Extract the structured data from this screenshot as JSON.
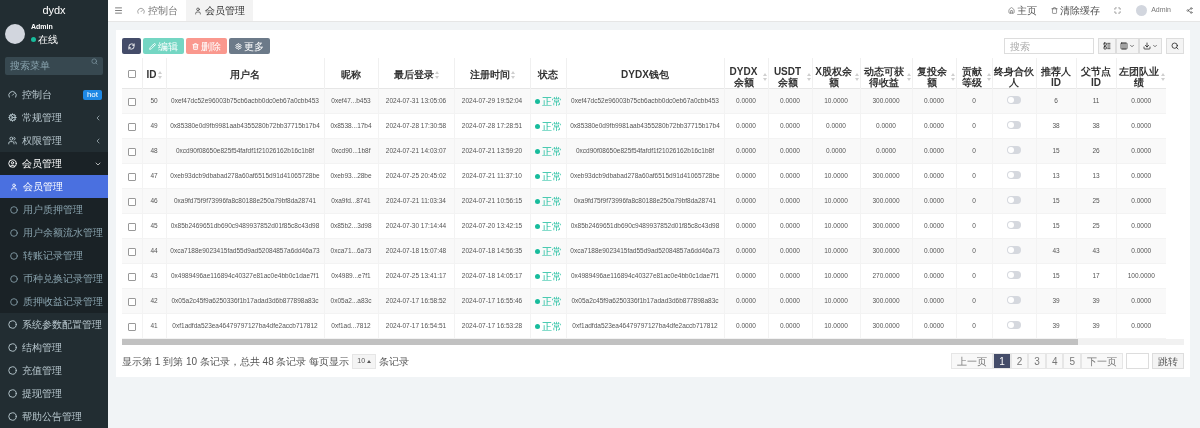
{
  "sidebar": {
    "brand": "dydx",
    "user": {
      "name": "Admin",
      "status": "在线",
      "online": true
    },
    "search": {
      "placeholder": "搜索菜单"
    },
    "items": [
      {
        "label": "控制台",
        "badge": "hot",
        "selected": false
      },
      {
        "label": "常规管理",
        "expanded": false,
        "selected": false
      },
      {
        "label": "权限管理",
        "expanded": false,
        "selected": false
      },
      {
        "label": "会员管理",
        "expanded": true,
        "selected": false,
        "children": [
          {
            "label": "会员管理",
            "selected": true
          },
          {
            "label": "用户质押管理",
            "selected": false
          },
          {
            "label": "用户余额流水管理",
            "selected": false
          },
          {
            "label": "转账记录管理",
            "selected": false
          },
          {
            "label": "币种兑换记录管理",
            "selected": false
          },
          {
            "label": "质押收益记录管理",
            "selected": false
          }
        ]
      },
      {
        "label": "系统参数配置管理",
        "selected": false
      },
      {
        "label": "结构管理",
        "selected": false
      },
      {
        "label": "充值管理",
        "selected": false
      },
      {
        "label": "提现管理",
        "selected": false
      },
      {
        "label": "帮助公告管理",
        "selected": false
      }
    ]
  },
  "header": {
    "tabs": [
      {
        "label": "控制台",
        "selected": false
      },
      {
        "label": "会员管理",
        "selected": true
      }
    ],
    "links": [
      {
        "kind": "home",
        "label": "主页"
      },
      {
        "kind": "clear",
        "label": "清除缓存"
      },
      {
        "kind": "fullscreen"
      },
      {
        "kind": "user",
        "label": "Admin"
      },
      {
        "kind": "share"
      }
    ]
  },
  "toolbar": {
    "buttons": [
      {
        "kind": "refresh",
        "disabled": false
      },
      {
        "kind": "edit",
        "label": "编辑",
        "disabled": true
      },
      {
        "kind": "delete",
        "label": "删除",
        "disabled": true
      },
      {
        "kind": "more",
        "label": "更多",
        "disabled": false
      }
    ],
    "search": {
      "placeholder": "搜索"
    }
  },
  "table": {
    "select_all": {
      "checked": false
    },
    "columns": [
      {
        "label": "ID",
        "sortable": true
      },
      {
        "label": "用户名",
        "sortable": false
      },
      {
        "label": "昵称",
        "sortable": false
      },
      {
        "label": "最后登录",
        "sortable": true
      },
      {
        "label": "注册时间",
        "sortable": true
      },
      {
        "label": "状态",
        "sortable": false
      },
      {
        "label": "DYDX钱包",
        "sortable": false
      },
      {
        "label": "DYDX余额",
        "sortable": true
      },
      {
        "label": "USDT余额",
        "sortable": true
      },
      {
        "label": "X股权余额",
        "sortable": true
      },
      {
        "label": "动态可获得收益",
        "sortable": true
      },
      {
        "label": "复投余额",
        "sortable": true
      },
      {
        "label": "贡献等级",
        "sortable": true
      },
      {
        "label": "终身合伙人",
        "sortable": false
      },
      {
        "label": "推荐人ID",
        "sortable": false
      },
      {
        "label": "父节点ID",
        "sortable": false
      },
      {
        "label": "左团队业绩",
        "sortable": true
      }
    ],
    "rows": [
      {
        "checked": false,
        "partner_on": false,
        "cells": [
          "50",
          "0xef47dc52e96003b75cb6acbb0dc0eb67a0cbb453",
          "0xef47...b453",
          "2024-07-31 13:05:06",
          "2024-07-29 19:52:04",
          "正常",
          "0xef47dc52e96003b75cb6acbb0dc0eb67a0cbb453",
          "0.0000",
          "0.0000",
          "10.0000",
          "300.0000",
          "0.0000",
          "0",
          "",
          "6",
          "11",
          "0.0000"
        ]
      },
      {
        "checked": false,
        "partner_on": false,
        "cells": [
          "49",
          "0x85380e0d9fb9981aab4355280b72bb37715b17b4",
          "0x8538...17b4",
          "2024-07-28 17:30:58",
          "2024-07-28 17:28:51",
          "正常",
          "0x85380e0d9fb9981aab4355280b72bb37715b17b4",
          "0.0000",
          "0.0000",
          "0.0000",
          "0.0000",
          "0.0000",
          "0",
          "",
          "38",
          "38",
          "0.0000"
        ]
      },
      {
        "checked": false,
        "partner_on": false,
        "cells": [
          "48",
          "0xcd90f08650e825f54fafdf1f21026162b16c1b8f",
          "0xcd90...1b8f",
          "2024-07-21 14:03:07",
          "2024-07-21 13:59:20",
          "正常",
          "0xcd90f08650e825f54fafdf1f21026162b16c1b8f",
          "0.0000",
          "0.0000",
          "0.0000",
          "0.0000",
          "0.0000",
          "0",
          "",
          "15",
          "26",
          "0.0000"
        ]
      },
      {
        "checked": false,
        "partner_on": false,
        "cells": [
          "47",
          "0xeb93dcb9dbabad278a60af6515d91d41065728be",
          "0xeb93...28be",
          "2024-07-25 20:45:02",
          "2024-07-21 11:37:10",
          "正常",
          "0xeb93dcb9dbabad278a60af6515d91d41065728be",
          "0.0000",
          "0.0000",
          "10.0000",
          "300.0000",
          "0.0000",
          "0",
          "",
          "13",
          "13",
          "0.0000"
        ]
      },
      {
        "checked": false,
        "partner_on": false,
        "cells": [
          "46",
          "0xa9fd75f9f73996fa8c80188e250a79bf8da28741",
          "0xa9fd...8741",
          "2024-07-21 11:03:34",
          "2024-07-21 10:56:15",
          "正常",
          "0xa9fd75f9f73996fa8c80188e250a79bf8da28741",
          "0.0000",
          "0.0000",
          "10.0000",
          "300.0000",
          "0.0000",
          "0",
          "",
          "15",
          "25",
          "0.0000"
        ]
      },
      {
        "checked": false,
        "partner_on": false,
        "cells": [
          "45",
          "0x85b2469651db690c9489937852d01f85c8c43d98",
          "0x85b2...3d98",
          "2024-07-30 17:14:44",
          "2024-07-20 13:42:15",
          "正常",
          "0x85b2469651db690c9489937852d01f85c8c43d98",
          "0.0000",
          "0.0000",
          "10.0000",
          "300.0000",
          "0.0000",
          "0",
          "",
          "15",
          "25",
          "0.0000"
        ]
      },
      {
        "checked": false,
        "partner_on": false,
        "cells": [
          "44",
          "0xca7188e9023415fad55d9ad52084857a6dd46a73",
          "0xca71...6a73",
          "2024-07-18 15:07:48",
          "2024-07-18 14:56:35",
          "正常",
          "0xca7188e9023415fad55d9ad52084857a6dd46a73",
          "0.0000",
          "0.0000",
          "10.0000",
          "300.0000",
          "0.0000",
          "0",
          "",
          "43",
          "43",
          "0.0000"
        ]
      },
      {
        "checked": false,
        "partner_on": false,
        "cells": [
          "43",
          "0x4989496ae116894c40327e81ac0e4bb0c1dae7f1",
          "0x4989...e7f1",
          "2024-07-25 13:41:17",
          "2024-07-18 14:05:17",
          "正常",
          "0x4989496ae116894c40327e81ac0e4bb0c1dae7f1",
          "0.0000",
          "0.0000",
          "10.0000",
          "270.0000",
          "0.0000",
          "0",
          "",
          "15",
          "17",
          "100.0000"
        ]
      },
      {
        "checked": false,
        "partner_on": false,
        "cells": [
          "42",
          "0x05a2c45f9a6250336f1b17adad3d6b877898a83c",
          "0x05a2...a83c",
          "2024-07-17 16:58:52",
          "2024-07-17 16:55:46",
          "正常",
          "0x05a2c45f9a6250336f1b17adad3d6b877898a83c",
          "0.0000",
          "0.0000",
          "10.0000",
          "300.0000",
          "0.0000",
          "0",
          "",
          "39",
          "39",
          "0.0000"
        ]
      },
      {
        "checked": false,
        "partner_on": false,
        "cells": [
          "41",
          "0xf1adfda523ea46479797127ba4dfe2accb717812",
          "0xf1ad...7812",
          "2024-07-17 16:54:51",
          "2024-07-17 16:53:28",
          "正常",
          "0xf1adfda523ea46479797127ba4dfe2accb717812",
          "0.0000",
          "0.0000",
          "10.0000",
          "300.0000",
          "0.0000",
          "0",
          "",
          "39",
          "39",
          "0.0000"
        ]
      }
    ]
  },
  "footer": {
    "summary": "显示第 1 到第 10 条记录，总共 48 条记录 每页显示",
    "page_size": "10",
    "page_size_suffix": "条记录",
    "pages": [
      {
        "label": "上一页",
        "selected": false
      },
      {
        "label": "1",
        "selected": true
      },
      {
        "label": "2",
        "selected": false
      },
      {
        "label": "3",
        "selected": false
      },
      {
        "label": "4",
        "selected": false
      },
      {
        "label": "5",
        "selected": false
      },
      {
        "label": "下一页",
        "selected": false
      }
    ],
    "jump": "跳转"
  }
}
